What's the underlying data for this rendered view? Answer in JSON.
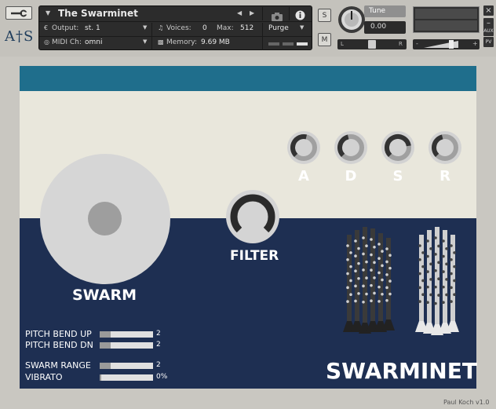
{
  "header": {
    "logo": "A†S",
    "title": "The Swarminet",
    "output_label": "Output:",
    "output_value": "st. 1",
    "voices_label": "Voices:",
    "voices_value": "0",
    "max_label": "Max:",
    "max_value": "512",
    "purge_label": "Purge",
    "midi_label": "MIDI Ch:",
    "midi_value": "omni",
    "memory_label": "Memory:",
    "memory_value": "9.69 MB",
    "solo_label": "S",
    "mute_label": "M",
    "tune_label": "Tune",
    "tune_value": "0.00",
    "pan_left": "L",
    "pan_right": "R",
    "vol_minus": "-",
    "vol_plus": "+",
    "aux_label": "AUX",
    "pv_label": "PV"
  },
  "instrument": {
    "adsr": [
      {
        "label": "A",
        "level": 0.55
      },
      {
        "label": "D",
        "level": 0.45
      },
      {
        "label": "S",
        "level": 0.8
      },
      {
        "label": "R",
        "level": 0.45
      }
    ],
    "filter_label": "FILTER",
    "swarm_label": "SWARM",
    "params": [
      {
        "label": "PITCH BEND UP",
        "value": "2",
        "fill": 0.2
      },
      {
        "label": "PITCH BEND DN",
        "value": "2",
        "fill": 0.2
      },
      {
        "label": "SWARM RANGE",
        "value": "2",
        "fill": 0.2
      },
      {
        "label": "VIBRATO",
        "value": "0%",
        "fill": 0.03
      }
    ],
    "brand": "SWARMINET"
  },
  "credit": "Paul Koch v1.0",
  "colors": {
    "teal": "#1f6e8c",
    "navy": "#1e2f52",
    "cream": "#e9e7dc"
  }
}
